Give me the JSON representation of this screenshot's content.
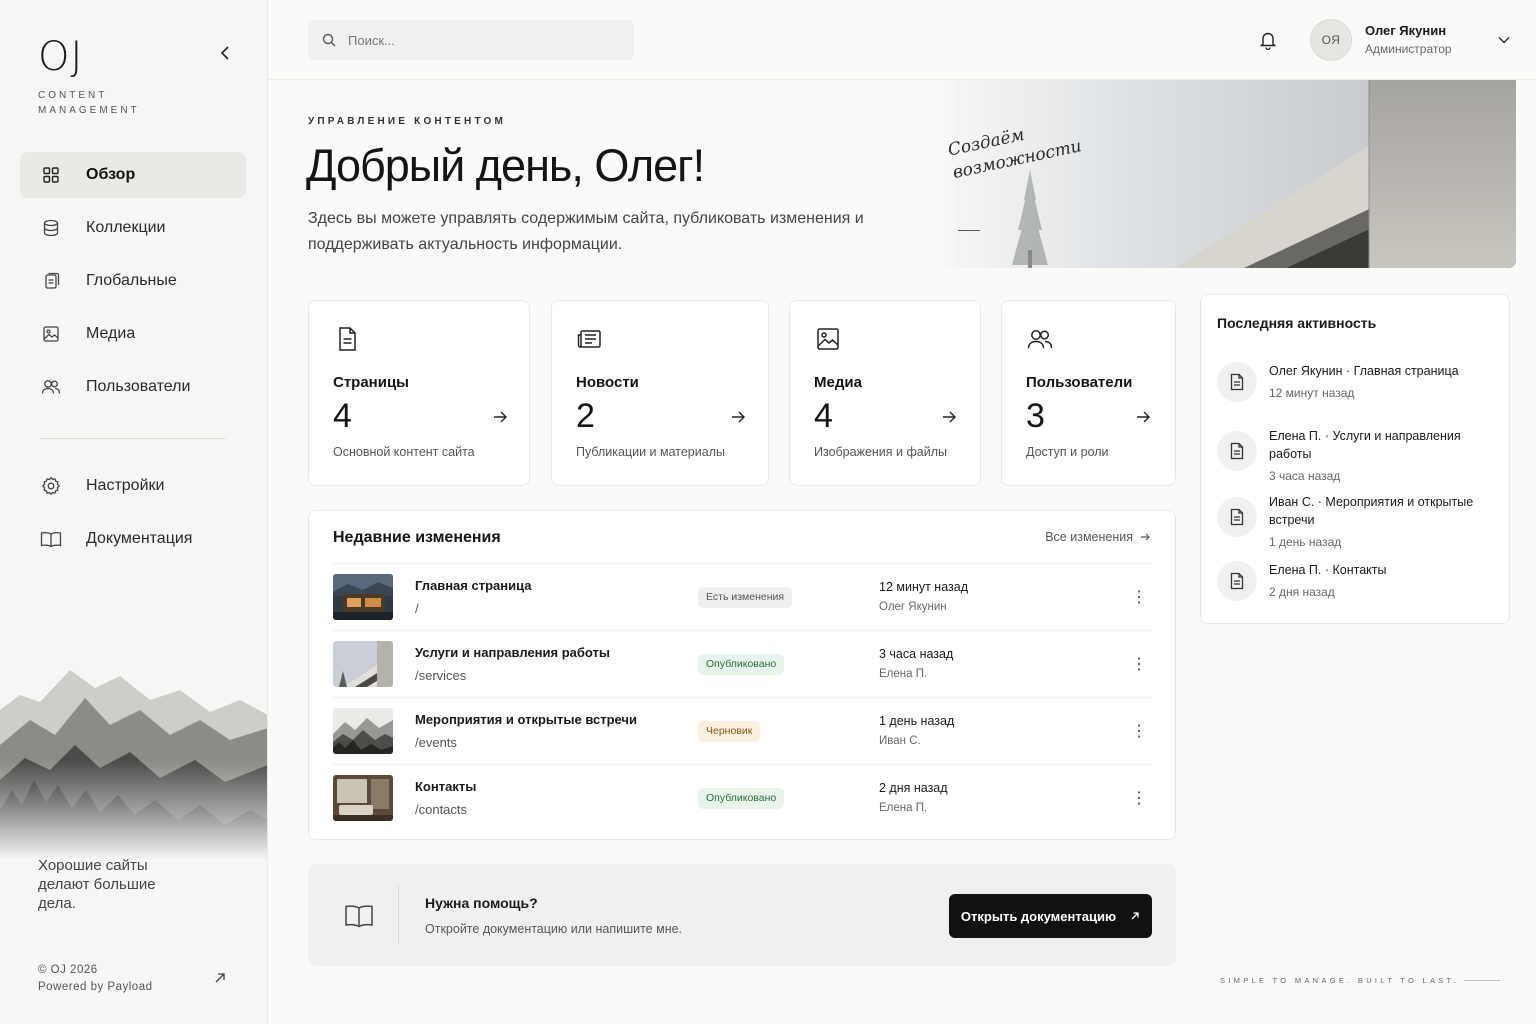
{
  "sidebar": {
    "logo": "OJ",
    "logo_sub": "CONTENT MANAGEMENT",
    "items": [
      {
        "label": "Обзор"
      },
      {
        "label": "Коллекции"
      },
      {
        "label": "Глобальные"
      },
      {
        "label": "Медиа"
      },
      {
        "label": "Пользователи"
      }
    ],
    "secondary": [
      {
        "label": "Настройки"
      },
      {
        "label": "Документация"
      }
    ],
    "tagline": "Хорошие сайты делают большие дела.",
    "copyright": "© OJ 2026",
    "powered": "Powered by Payload"
  },
  "topbar": {
    "search_placeholder": "Поиск...",
    "user_initials": "ОЯ",
    "user_name": "Олег Якунин",
    "user_role": "Администратор"
  },
  "hero": {
    "eyebrow": "УПРАВЛЕНИЕ КОНТЕНТОМ",
    "title": "Добрый день, Олег!",
    "lead": "Здесь вы можете управлять содержимым сайта, публиковать изменения и поддерживать актуальность информации.",
    "script_line1": "Создаём",
    "script_line2": "возможности"
  },
  "stats": [
    {
      "title": "Страницы",
      "count": "4",
      "desc": "Основной контент сайта",
      "icon": "file-icon"
    },
    {
      "title": "Новости",
      "count": "2",
      "desc": "Публикации и материалы",
      "icon": "newspaper-icon"
    },
    {
      "title": "Медиа",
      "count": "4",
      "desc": "Изображения и файлы",
      "icon": "image-icon"
    },
    {
      "title": "Пользователи",
      "count": "3",
      "desc": "Доступ и роли",
      "icon": "users-icon"
    }
  ],
  "changes": {
    "title": "Недавние изменения",
    "all_link": "Все изменения",
    "rows": [
      {
        "title": "Главная страница",
        "path": "/",
        "status": "Есть изменения",
        "time": "12 минут назад",
        "author": "Олег Якунин"
      },
      {
        "title": "Услуги и направления работы",
        "path": "/services",
        "status": "Опубликовано",
        "time": "3 часа назад",
        "author": "Елена П."
      },
      {
        "title": "Мероприятия и открытые встречи",
        "path": "/events",
        "status": "Черновик",
        "time": "1 день назад",
        "author": "Иван С."
      },
      {
        "title": "Контакты",
        "path": "/contacts",
        "status": "Опубликовано",
        "time": "2 дня назад",
        "author": "Елена П."
      }
    ]
  },
  "activity": {
    "title": "Последняя активность",
    "items": [
      {
        "text": "Олег Якунин · Главная страница",
        "time": "12 минут назад"
      },
      {
        "text": "Елена П. · Услуги и направления работы",
        "time": "3 часа назад"
      },
      {
        "text": "Иван С. · Мероприятия и открытые встречи",
        "time": "1 день назад"
      },
      {
        "text": "Елена П. · Контакты",
        "time": "2 дня назад"
      }
    ]
  },
  "help": {
    "title": "Нужна помощь?",
    "subtitle": "Откройте документацию или напишите мне.",
    "button": "Открыть документацию"
  },
  "footer_slogan": "SIMPLE TO MANAGE. BUILT TO LAST.",
  "colors": {
    "accent": "#111111",
    "badge_published": "#e8f4ea",
    "badge_draft": "#fbf0df",
    "badge_changes": "#efeeec"
  }
}
